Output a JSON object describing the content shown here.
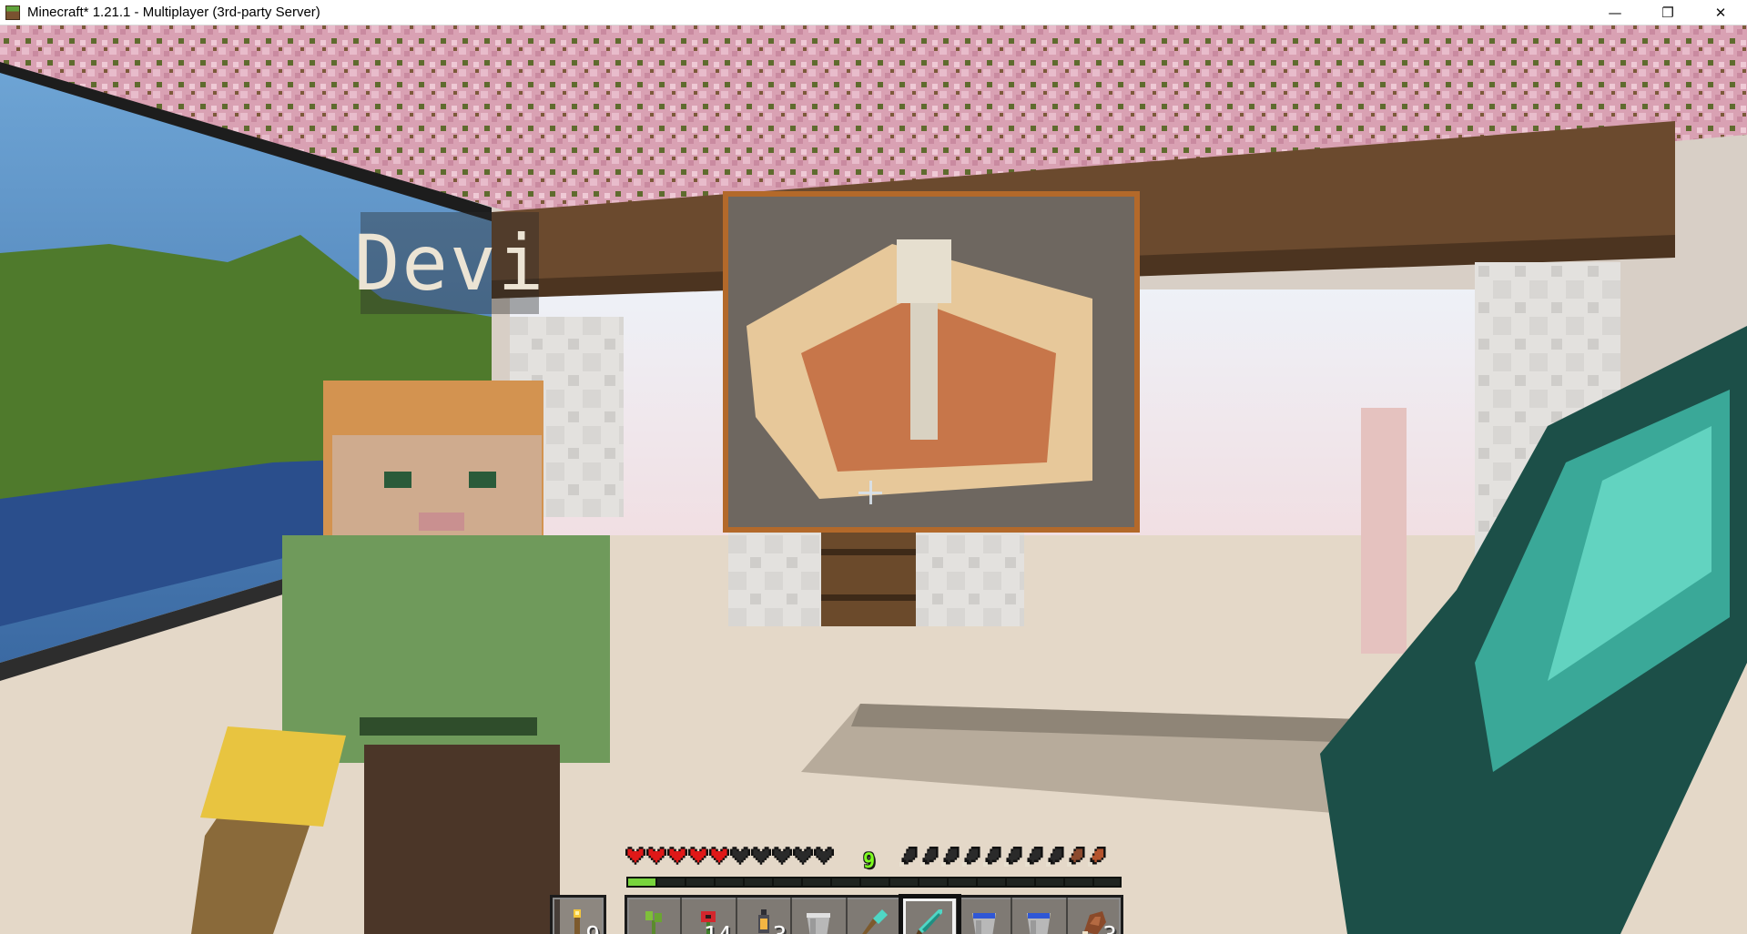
{
  "window": {
    "title": "Minecraft* 1.21.1 - Multiplayer (3rd-party Server)",
    "controls": {
      "minimize": "—",
      "restore": "❐",
      "close": "✕"
    }
  },
  "player_nametag": "Devi",
  "hud": {
    "health": {
      "full_hearts": 5,
      "total_hearts": 10
    },
    "hunger": {
      "full": 1,
      "half": 1,
      "empty": 8,
      "total": 10
    },
    "xp_level": "9",
    "xp_progress": 0.06,
    "offhand": {
      "item": "torch-icon",
      "count": "9"
    },
    "selected_slot": 5,
    "hotbar": [
      {
        "item": "sapling-icon",
        "count": ""
      },
      {
        "item": "poppy-icon",
        "count": "14"
      },
      {
        "item": "lantern-icon",
        "count": "3"
      },
      {
        "item": "bucket-icon",
        "count": ""
      },
      {
        "item": "diamond-shovel-icon",
        "count": ""
      },
      {
        "item": "diamond-sword-icon",
        "count": ""
      },
      {
        "item": "water-bucket-icon",
        "count": ""
      },
      {
        "item": "water-bucket-icon",
        "count": ""
      },
      {
        "item": "cooked-meat-icon",
        "count": "3"
      }
    ]
  }
}
